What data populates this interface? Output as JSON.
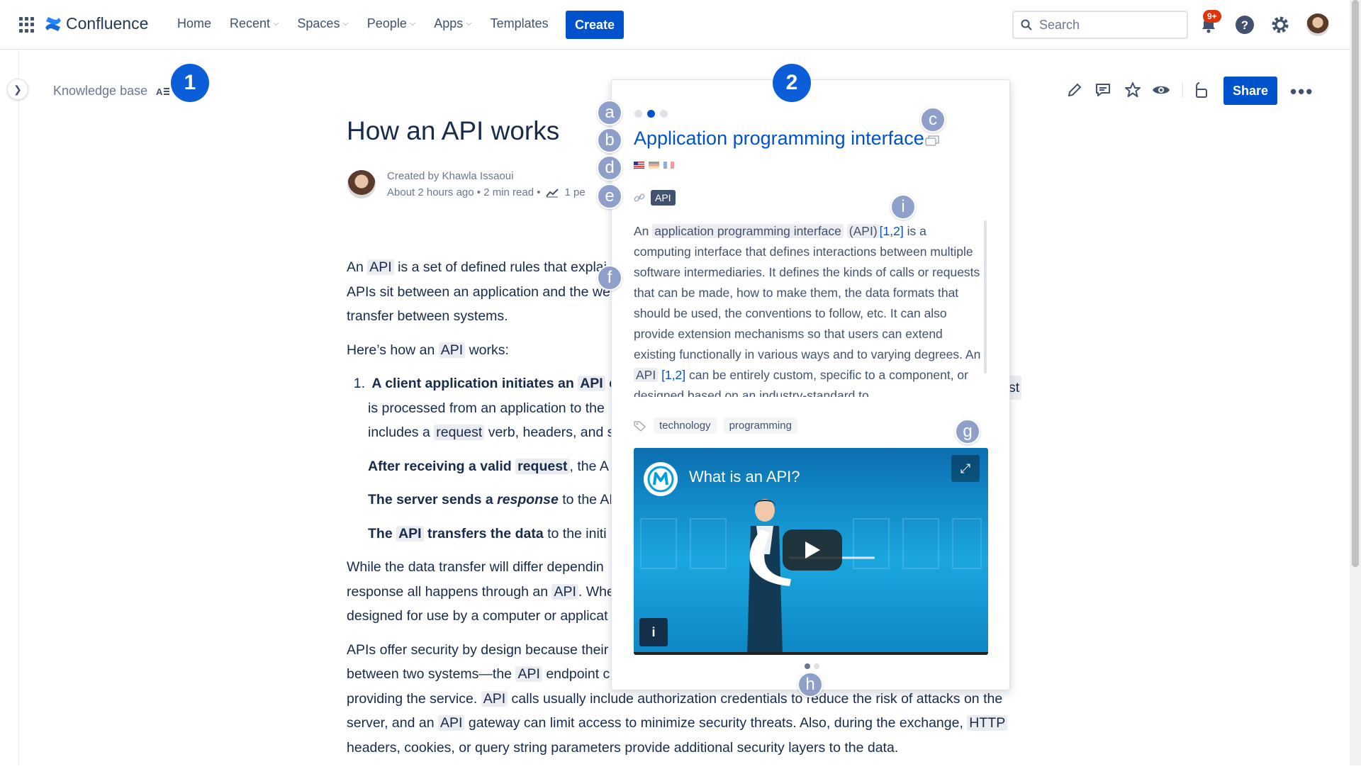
{
  "topbar": {
    "app_name": "Confluence",
    "nav": [
      "Home",
      "Recent",
      "Spaces",
      "People",
      "Apps",
      "Templates"
    ],
    "create_label": "Create",
    "search_placeholder": "Search",
    "notification_count": "9+"
  },
  "breadcrumb": {
    "space": "Knowledge base"
  },
  "callouts": {
    "one": "1",
    "two": "2"
  },
  "page_actions": {
    "share_label": "Share"
  },
  "page": {
    "title": "How an API works",
    "created_by": "Created by Khawla Issaoui",
    "meta": "About 2 hours ago • 2 min read •",
    "views": "1 pe",
    "body": {
      "p1a": "An",
      "p1api": "API",
      "p1b": "is a set of defined rules that explai",
      "p1c": "APIs sit between an application and the we",
      "p1d": "transfer between systems.",
      "p2a": "Here’s how an",
      "p2api": "API",
      "p2b": "works:",
      "li1a": "1.",
      "li1b": "A client application initiates an",
      "li1api": "API",
      "li1c": "c",
      "li1d": "is processed from an application to the",
      "li1e": "includes a",
      "li1req": "request",
      "li1f": "verb, headers, and s",
      "li2a": "After receiving a valid",
      "li2req": "request",
      "li2b": ", the A",
      "li3a": "The server sends a",
      "li3em": "response",
      "li3b": "to the AP",
      "li4a": "The",
      "li4api": "API",
      "li4b": "transfers the data",
      "li4c": "to the initi",
      "p3a": "While the data transfer will differ dependin",
      "p3b": "response all happens through an",
      "p3api": "API",
      "p3c": ". Whe",
      "p3d": "designed for use by a computer or applicat",
      "p4a": "APIs offer security by design because their",
      "p4b": "between two systems—the",
      "p4api": "API",
      "p4c": "endpoint c",
      "p4d": "providing the service.",
      "p4api2": "API",
      "p4e": "calls usually include authorization credentials to reduce the risk of attacks on the",
      "p4f": "server, and an",
      "p4api3": "API",
      "p4g": "gateway can limit access to minimize security threats. Also, during the exchange,",
      "p4http": "HTTP",
      "p4h": "headers, cookies, or query string parameters provide additional security layers to the data.",
      "side_st": "st"
    }
  },
  "popup": {
    "title": "Application programming interface",
    "alias": "API",
    "desc": {
      "a": "An",
      "term": "application programming interface",
      "paren": "(API)",
      "ref": "[1,2]",
      "b": "is a computing interface that defines interactions between multiple software intermediaries. It defines the kinds of calls or requests that can be made, how to make them, the data formats that should be used, the conventions to follow, etc. It can also provide extension mechanisms so that users can extend existing functionally in various ways and to varying degrees. An",
      "api": "API",
      "ref2": "[1,2]",
      "c": "can be entirely custom, specific to a component, or designed based on an industry-standard to"
    },
    "tags": [
      "technology",
      "programming"
    ],
    "video_title": "What is an API?",
    "video_info": "i"
  },
  "letters": [
    "a",
    "b",
    "c",
    "d",
    "e",
    "f",
    "g",
    "h",
    "i"
  ]
}
